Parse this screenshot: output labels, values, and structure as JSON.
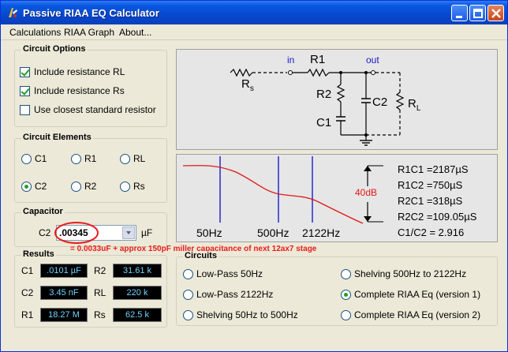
{
  "window": {
    "title": "Passive RIAA EQ Calculator",
    "controls": [
      "minimize-icon",
      "maximize-icon",
      "close-icon"
    ]
  },
  "menu": {
    "items": [
      {
        "label": "Calculations"
      },
      {
        "label": "RIAA Graph"
      },
      {
        "label": "About..."
      }
    ]
  },
  "circuit_options": {
    "title": "Circuit Options",
    "items": [
      {
        "label": "Include resistance RL",
        "checked": true
      },
      {
        "label": "Include resistance Rs",
        "checked": true
      },
      {
        "label": "Use closest standard resistor",
        "checked": false
      }
    ]
  },
  "circuit_elements": {
    "title": "Circuit Elements",
    "items": [
      {
        "label": "C1",
        "selected": false
      },
      {
        "label": "R1",
        "selected": false
      },
      {
        "label": "RL",
        "selected": false
      },
      {
        "label": "C2",
        "selected": true
      },
      {
        "label": "R2",
        "selected": false
      },
      {
        "label": "Rs",
        "selected": false
      }
    ]
  },
  "capacitor": {
    "title": "Capacitor",
    "field_label": "C2",
    "value": ".00345",
    "unit": "µF",
    "note": "= 0.0033uF + approx 150pF miller capacitance of next 12ax7 stage"
  },
  "results": {
    "title": "Results",
    "items": [
      {
        "label": "C1",
        "value": ".0101 µF"
      },
      {
        "label": "R2",
        "value": "31.61 k"
      },
      {
        "label": "C2",
        "value": "3.45 nF"
      },
      {
        "label": "RL",
        "value": "220 k"
      },
      {
        "label": "R1",
        "value": "18.27 M"
      },
      {
        "label": "Rs",
        "value": "62.5 k"
      }
    ]
  },
  "schematic": {
    "in_label": "in",
    "out_label": "out",
    "r1": "R1",
    "rs": "R",
    "rs_sub": "s",
    "r2": "R2",
    "c1": "C1",
    "c2": "C2",
    "rl": "R",
    "rl_sub": "L",
    "accent": "#1a1ac8"
  },
  "graph": {
    "db_label": "40dB",
    "freq_labels": [
      "50Hz",
      "500Hz",
      "2122Hz"
    ],
    "time_constants": [
      "R1C1 =2187µS",
      "R1C2 =750µS",
      "R2C1 =318µS",
      "R2C2 =109.05µS",
      "C1/C2 = 2.916"
    ],
    "curve_color": "#e01818",
    "marker_color": "#1a1ac8"
  },
  "circuits": {
    "title": "Circuits",
    "items": [
      {
        "label": "Low-Pass 50Hz",
        "selected": false
      },
      {
        "label": "Shelving 500Hz to 2122Hz",
        "selected": false
      },
      {
        "label": "Low-Pass 2122Hz",
        "selected": false
      },
      {
        "label": "Complete RIAA Eq (version 1)",
        "selected": true
      },
      {
        "label": "Shelving 50Hz to 500Hz",
        "selected": false
      },
      {
        "label": "Complete RIAA Eq (version 2)",
        "selected": false
      }
    ]
  }
}
